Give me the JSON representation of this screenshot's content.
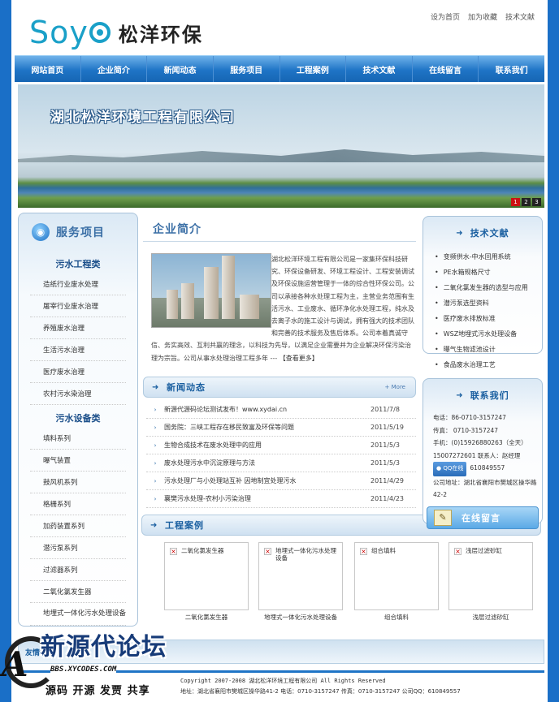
{
  "header": {
    "logo_en": "Soy",
    "logo_cn": "松洋环保",
    "top_links": [
      "设为首页",
      "加为收藏",
      "技术文献"
    ]
  },
  "nav": [
    "网站首页",
    "企业简介",
    "新闻动态",
    "服务项目",
    "工程案例",
    "技术文献",
    "在线留言",
    "联系我们"
  ],
  "banner": {
    "title": "湖北松洋环境工程有限公司",
    "pager": [
      "1",
      "2",
      "3"
    ]
  },
  "left": {
    "title": "服务项目",
    "cat1": "污水工程类",
    "cat1_items": [
      "造纸行业废水处理",
      "屠宰行业废水治理",
      "养殖废水治理",
      "生活污水治理",
      "医疗废水治理",
      "农村污水染治理"
    ],
    "cat2": "污水设备类",
    "cat2_items": [
      "填料系列",
      "曝气装置",
      "鼓风机系列",
      "格栅系列",
      "加药装置系列",
      "潜污泵系列",
      "过滤器系列",
      "二氧化氯发生器",
      "地埋式一体化污水处理设备"
    ]
  },
  "about": {
    "title": "企业简介",
    "p1": "湖北松洋环境工程有限公司是一家集环保科技研究、环保设备研发、环境工程设计、工程安装调试及环保设施运营管理于一体的综合性环保公司。公司以承接各种水处理工程为主，主营业务范围有生活污水、工业废水、循环净化水处理工程，纯水及去离子水的施工设计与调试，拥有强大的技术团队和完善的技术服务及售后体系。公司本着真诚守",
    "p2": "信、务实高效、互利共赢的理念，以科技为先导，以满足企业需要并为企业解决环保污染治理为宗旨。公司从事水处理治理工程多年 ---",
    "more": "【查看更多】"
  },
  "news": {
    "title": "新闻动态",
    "more": "+ More",
    "items": [
      {
        "title": "新源代源码论坛测试发布！www.xydai.cn",
        "date": "2011/7/8"
      },
      {
        "title": "国务院：三峡工程存在移民致富及环保等问题",
        "date": "2011/5/19"
      },
      {
        "title": "生物合成技术在废水处理中的应用",
        "date": "2011/5/3"
      },
      {
        "title": "废水处理污水中沉淀原理与方法",
        "date": "2011/5/3"
      },
      {
        "title": "污水处理厂与小处理站互补 因地制宜处理污水",
        "date": "2011/4/29"
      },
      {
        "title": "襄樊污水处理-农村小污染治理",
        "date": "2011/4/23"
      }
    ]
  },
  "cases": {
    "title": "工程案例",
    "items": [
      {
        "name": "二氧化氯发生器",
        "cap": "二氧化氯发生器"
      },
      {
        "name": "地埋式一体化污水处理设备",
        "cap": "地埋式一体化污水处理设备"
      },
      {
        "name": "组合填料",
        "cap": "组合填料"
      },
      {
        "name": "浅层过滤砂缸",
        "cap": "浅层过滤砂缸"
      }
    ]
  },
  "tech": {
    "title": "技术文献",
    "items": [
      "变频供水-中水回用系统",
      "PE水箱规格尺寸",
      "二氧化氯发生器的选型与应用",
      "潜污泵选型资料",
      "医疗废水排放标准",
      "WSZ地埋式污水处理设备",
      "曝气生物滤池设计",
      "食品废水治理工艺"
    ]
  },
  "contact": {
    "title": "联系我们",
    "phone": "电话：86-0710-3157247",
    "fax": "传真： 0710-3157247",
    "mobile": "手机：(0)15926880263（全天）",
    "mobile2": "15007272601 联系人：赵经理",
    "qq_btn": "QQ在线",
    "qq_num": "610849557",
    "address": "公司地址：湖北省襄阳市樊城区操华路42-2",
    "msg_btn": "在线留言"
  },
  "footer": {
    "friend": "友情链接",
    "copyright": "Copyright 2007-2008 湖北松洋环境工程有限公司 All Rights Reserved",
    "address": "地址：湖北省襄阳市樊城区操华路41-2 电话：0710-3157247 传真：0710-3157247 公司QQ：610849557"
  },
  "watermark": {
    "big": "新源代论坛",
    "url": "BBS.XYCODES.COM",
    "tag": "源码 开源 发贾 共享",
    "glyph": "A"
  }
}
